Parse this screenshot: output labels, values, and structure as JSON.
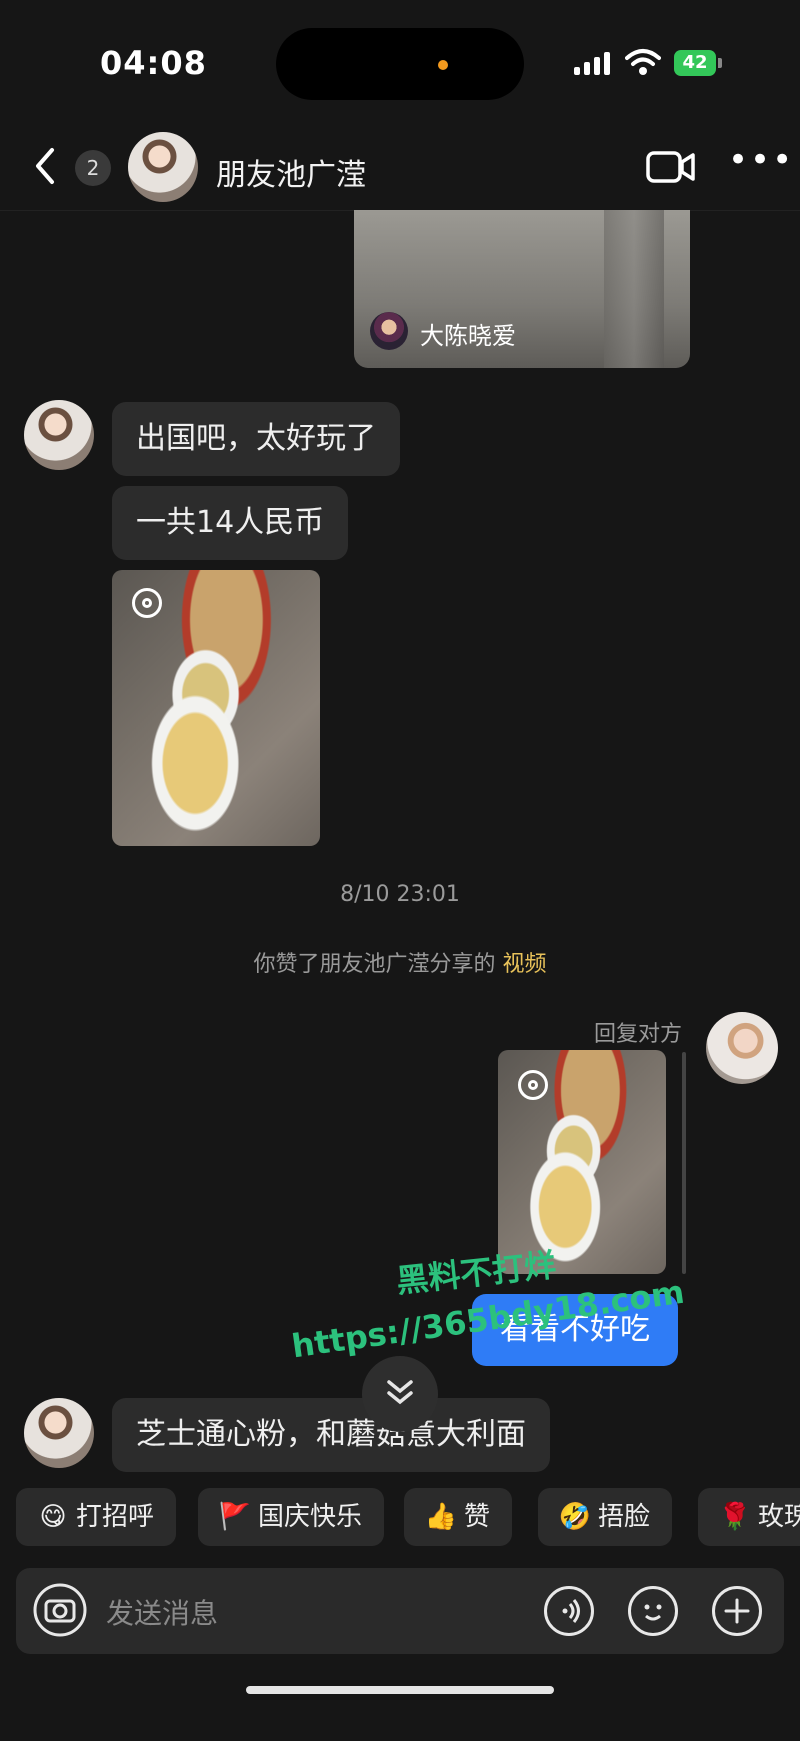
{
  "status_bar": {
    "time": "04:08",
    "battery": "42"
  },
  "header": {
    "unread_count": "2",
    "title": "朋友池广滢"
  },
  "shared_card": {
    "sharer_name": "大陈晓爱"
  },
  "messages": {
    "m1": "出国吧，太好玩了",
    "m2": "一共14人民币",
    "m_last": "芝士通心粉，和蘑菇意大利面"
  },
  "timestamp": "8/10 23:01",
  "system_note": {
    "text": "你赞了朋友池广滢分享的 ",
    "link": "视频"
  },
  "reply_label": "回复对方",
  "my_message": "看看不好吃",
  "watermark": {
    "line1": "黑料不打烊",
    "line2": "https://365bdy18.com"
  },
  "quick_replies": [
    {
      "emoji": "😋",
      "label": "打招呼"
    },
    {
      "emoji": "🚩",
      "label": "国庆快乐"
    },
    {
      "emoji": "👍",
      "label": "赞"
    },
    {
      "emoji": "🤣",
      "label": "捂脸"
    },
    {
      "emoji": "🌹",
      "label": "玫瑰"
    }
  ],
  "input": {
    "placeholder": "发送消息"
  },
  "colors": {
    "background": "#161616",
    "bubble": "#2c2c2c",
    "my_bubble": "#2f7cf6",
    "link": "#e8c25a",
    "watermark": "#2cc17d"
  }
}
